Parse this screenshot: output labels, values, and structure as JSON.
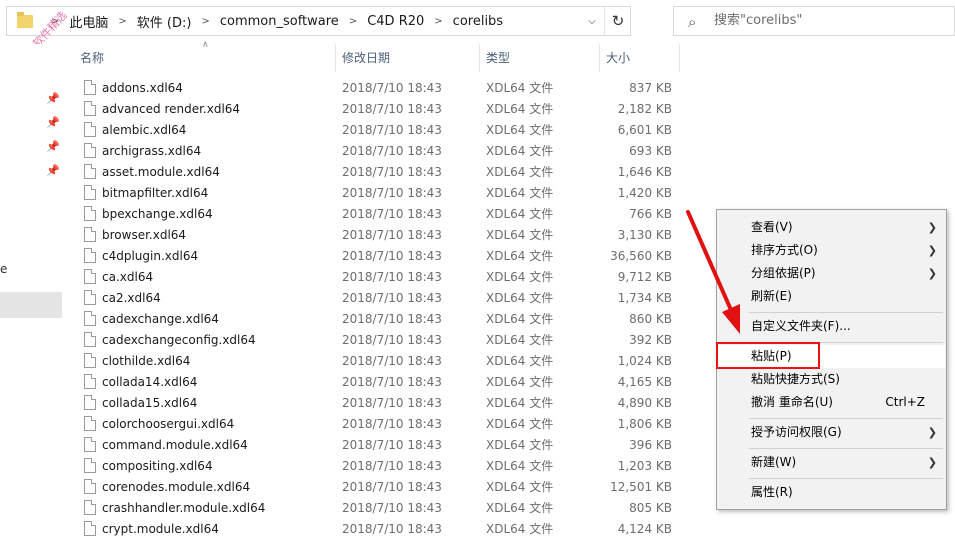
{
  "address": {
    "crumbs": [
      "此电脑",
      "软件 (D:)",
      "common_software",
      "C4D R20",
      "corelibs"
    ]
  },
  "search": {
    "placeholder": "搜索\"corelibs\""
  },
  "watermark": "公众号: 软件精选",
  "nav": {
    "partial_label": "e"
  },
  "columns": {
    "name": "名称",
    "date": "修改日期",
    "type": "类型",
    "size": "大小"
  },
  "files": [
    {
      "name": "addons.xdl64",
      "date": "2018/7/10 18:43",
      "type": "XDL64 文件",
      "size": "837 KB"
    },
    {
      "name": "advanced render.xdl64",
      "date": "2018/7/10 18:43",
      "type": "XDL64 文件",
      "size": "2,182 KB"
    },
    {
      "name": "alembic.xdl64",
      "date": "2018/7/10 18:43",
      "type": "XDL64 文件",
      "size": "6,601 KB"
    },
    {
      "name": "archigrass.xdl64",
      "date": "2018/7/10 18:43",
      "type": "XDL64 文件",
      "size": "693 KB"
    },
    {
      "name": "asset.module.xdl64",
      "date": "2018/7/10 18:43",
      "type": "XDL64 文件",
      "size": "1,646 KB"
    },
    {
      "name": "bitmapfilter.xdl64",
      "date": "2018/7/10 18:43",
      "type": "XDL64 文件",
      "size": "1,420 KB"
    },
    {
      "name": "bpexchange.xdl64",
      "date": "2018/7/10 18:43",
      "type": "XDL64 文件",
      "size": "766 KB"
    },
    {
      "name": "browser.xdl64",
      "date": "2018/7/10 18:43",
      "type": "XDL64 文件",
      "size": "3,130 KB"
    },
    {
      "name": "c4dplugin.xdl64",
      "date": "2018/7/10 18:43",
      "type": "XDL64 文件",
      "size": "36,560 KB"
    },
    {
      "name": "ca.xdl64",
      "date": "2018/7/10 18:43",
      "type": "XDL64 文件",
      "size": "9,712 KB"
    },
    {
      "name": "ca2.xdl64",
      "date": "2018/7/10 18:43",
      "type": "XDL64 文件",
      "size": "1,734 KB"
    },
    {
      "name": "cadexchange.xdl64",
      "date": "2018/7/10 18:43",
      "type": "XDL64 文件",
      "size": "860 KB"
    },
    {
      "name": "cadexchangeconfig.xdl64",
      "date": "2018/7/10 18:43",
      "type": "XDL64 文件",
      "size": "392 KB"
    },
    {
      "name": "clothilde.xdl64",
      "date": "2018/7/10 18:43",
      "type": "XDL64 文件",
      "size": "1,024 KB"
    },
    {
      "name": "collada14.xdl64",
      "date": "2018/7/10 18:43",
      "type": "XDL64 文件",
      "size": "4,165 KB"
    },
    {
      "name": "collada15.xdl64",
      "date": "2018/7/10 18:43",
      "type": "XDL64 文件",
      "size": "4,890 KB"
    },
    {
      "name": "colorchoosergui.xdl64",
      "date": "2018/7/10 18:43",
      "type": "XDL64 文件",
      "size": "1,806 KB"
    },
    {
      "name": "command.module.xdl64",
      "date": "2018/7/10 18:43",
      "type": "XDL64 文件",
      "size": "396 KB"
    },
    {
      "name": "compositing.xdl64",
      "date": "2018/7/10 18:43",
      "type": "XDL64 文件",
      "size": "1,203 KB"
    },
    {
      "name": "corenodes.module.xdl64",
      "date": "2018/7/10 18:43",
      "type": "XDL64 文件",
      "size": "12,501 KB"
    },
    {
      "name": "crashhandler.module.xdl64",
      "date": "2018/7/10 18:43",
      "type": "XDL64 文件",
      "size": "805 KB"
    },
    {
      "name": "crypt.module.xdl64",
      "date": "2018/7/10 18:43",
      "type": "XDL64 文件",
      "size": "4,124 KB"
    }
  ],
  "context_menu": {
    "view": "查看(V)",
    "sort": "排序方式(O)",
    "group": "分组依据(P)",
    "refresh": "刷新(E)",
    "customize": "自定义文件夹(F)...",
    "paste": "粘贴(P)",
    "paste_shortcut": "粘贴快捷方式(S)",
    "undo_rename": "撤消 重命名(U)",
    "undo_shortcut": "Ctrl+Z",
    "give_access": "授予访问权限(G)",
    "new": "新建(W)",
    "properties": "属性(R)"
  },
  "colors": {
    "annotation_red": "#e11111",
    "menu_bg": "#f2f2f2",
    "header_text": "#4c607a"
  }
}
